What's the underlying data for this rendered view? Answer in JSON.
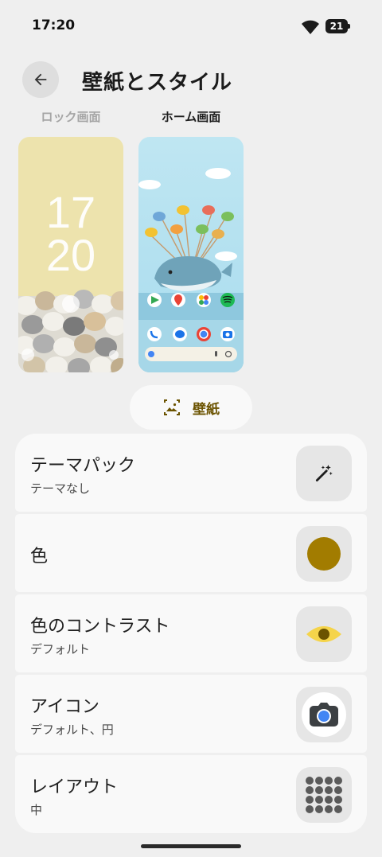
{
  "status_bar": {
    "time": "17:20",
    "battery_level": "21",
    "icons": [
      "wifi-icon",
      "battery-icon"
    ]
  },
  "header": {
    "title": "壁紙とスタイル",
    "back_icon": "arrow-back-icon"
  },
  "preview_tabs": {
    "lock": "ロック画面",
    "home": "ホーム画面",
    "selected": "home"
  },
  "lock_preview": {
    "clock_hours": "17",
    "clock_minutes": "20"
  },
  "wallpaper_button": {
    "label": "壁紙",
    "icon": "wallpaper-icon"
  },
  "settings": {
    "theme_pack": {
      "title": "テーマパック",
      "subtitle": "テーマなし",
      "icon": "magic-wand-icon"
    },
    "color": {
      "title": "色",
      "icon": "color-swatch-icon",
      "swatch_color": "#a27c00"
    },
    "contrast": {
      "title": "色のコントラスト",
      "subtitle": "デフォルト",
      "icon": "eye-icon"
    },
    "icons": {
      "title": "アイコン",
      "subtitle": "デフォルト、円",
      "icon": "camera-icon"
    },
    "layout": {
      "title": "レイアウト",
      "subtitle": "中",
      "icon": "grid-icon"
    }
  },
  "colors": {
    "accent_text": "#6b5300",
    "background": "#efefef",
    "card": "#f9f9f9"
  }
}
